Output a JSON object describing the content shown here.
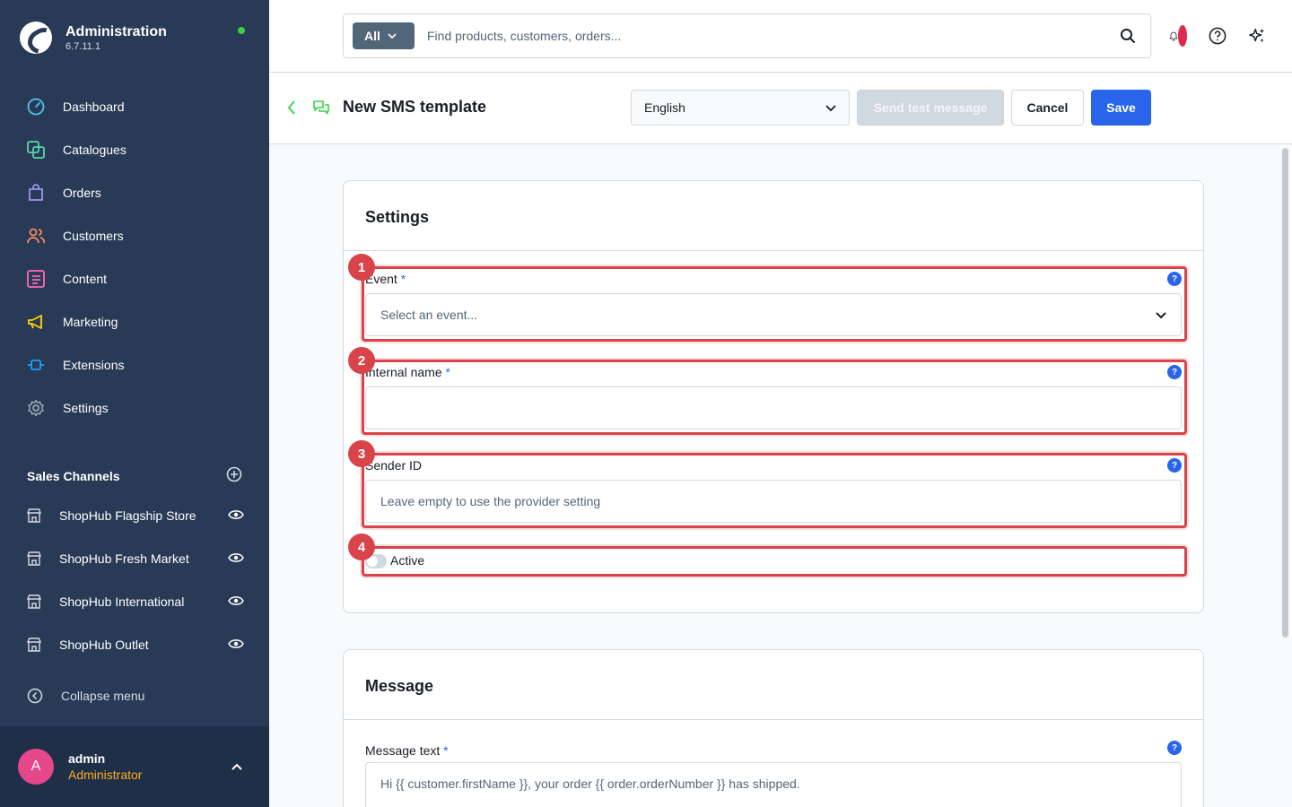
{
  "app": {
    "title": "Administration",
    "version": "6.7.11.1"
  },
  "sidebar": {
    "items": [
      {
        "label": "Dashboard",
        "icon": "dashboard-icon",
        "color": "#52c4e8"
      },
      {
        "label": "Catalogues",
        "icon": "catalogues-icon",
        "color": "#57d9a3"
      },
      {
        "label": "Orders",
        "icon": "orders-icon",
        "color": "#a092f0"
      },
      {
        "label": "Customers",
        "icon": "customers-icon",
        "color": "#f88962"
      },
      {
        "label": "Content",
        "icon": "content-icon",
        "color": "#ff68b4"
      },
      {
        "label": "Marketing",
        "icon": "marketing-icon",
        "color": "#ffd700"
      },
      {
        "label": "Extensions",
        "icon": "extensions-icon",
        "color": "#189eff"
      },
      {
        "label": "Settings",
        "icon": "settings-icon",
        "color": "#9aa8b5"
      }
    ],
    "sales_channels_title": "Sales Channels",
    "sales_channels": [
      {
        "label": "ShopHub Flagship Store"
      },
      {
        "label": "ShopHub Fresh Market"
      },
      {
        "label": "ShopHub International"
      },
      {
        "label": "ShopHub Outlet"
      }
    ],
    "collapse_label": "Collapse menu"
  },
  "user": {
    "initial": "A",
    "name": "admin",
    "role": "Administrator"
  },
  "search": {
    "filter_label": "All",
    "placeholder": "Find products, customers, orders..."
  },
  "smartbar": {
    "title": "New SMS template",
    "language": "English",
    "send_test_label": "Send test message",
    "cancel_label": "Cancel",
    "save_label": "Save"
  },
  "settings_card": {
    "title": "Settings",
    "event_label": "Event",
    "event_placeholder": "Select an event...",
    "internal_name_label": "Internal name",
    "internal_name_value": "",
    "sender_id_label": "Sender ID",
    "sender_id_placeholder": "Leave empty to use the provider setting",
    "active_label": "Active",
    "active": false,
    "required_mark": "*",
    "help_glyph": "?",
    "markers": [
      "1",
      "2",
      "3",
      "4"
    ]
  },
  "message_card": {
    "title": "Message",
    "message_text_label": "Message text",
    "message_text_placeholder": "Hi {{ customer.firstName }}, your order {{ order.orderNumber }} has shipped."
  },
  "colors": {
    "accent": "#2965ea",
    "sidebar_bg": "#283a56",
    "highlight": "#d9434a",
    "online_status": "#37d046",
    "role": "#ffab22"
  }
}
